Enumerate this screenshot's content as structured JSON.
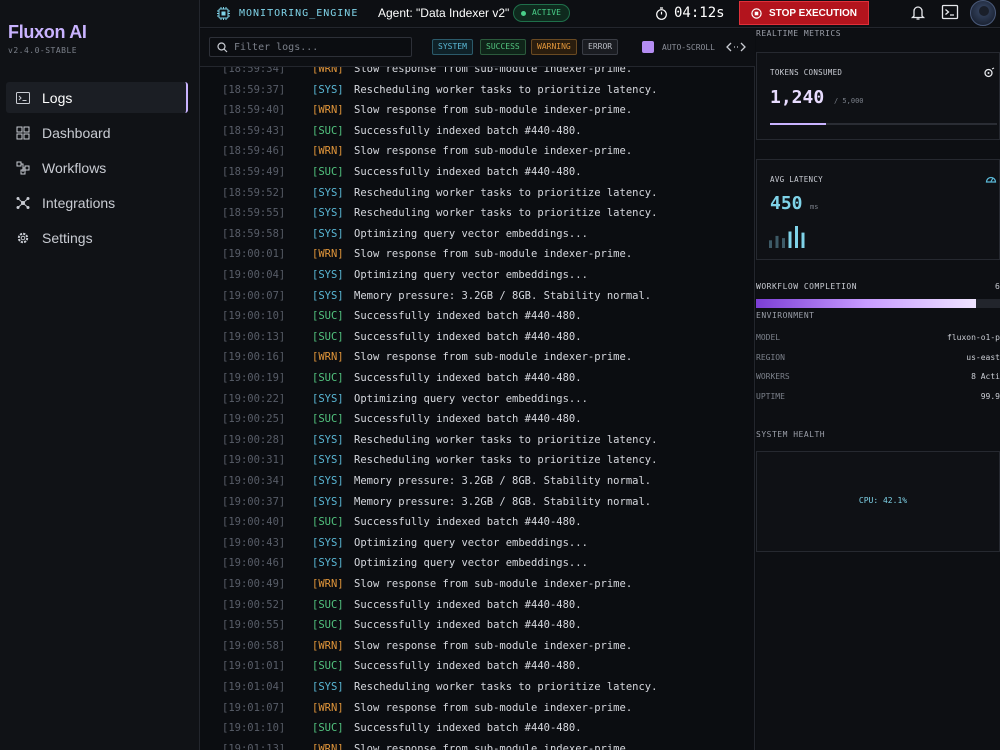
{
  "app": {
    "name": "Fluxon AI",
    "version": "v2.4.0-STABLE"
  },
  "sidebar": {
    "items": [
      {
        "label": "Logs",
        "icon": "terminal-icon",
        "active": true
      },
      {
        "label": "Dashboard",
        "icon": "grid-icon",
        "active": false
      },
      {
        "label": "Workflows",
        "icon": "workflow-icon",
        "active": false
      },
      {
        "label": "Integrations",
        "icon": "hub-icon",
        "active": false
      },
      {
        "label": "Settings",
        "icon": "gear-icon",
        "active": false
      }
    ]
  },
  "topbar": {
    "engine_label": "MONITORING_ENGINE",
    "agent_label": "Agent: \"Data Indexer v2\"",
    "status_badge": "ACTIVE",
    "timer": "04:12s",
    "stop_label": "STOP EXECUTION"
  },
  "filters": {
    "search_placeholder": "Filter logs...",
    "chips": [
      "SYSTEM",
      "SUCCESS",
      "WARNING",
      "ERROR"
    ],
    "autoscroll_label": "AUTO-SCROLL"
  },
  "logs": [
    {
      "time": "[18:59:34]",
      "tag": "WRN",
      "msg": "Slow response from sub-module indexer-prime."
    },
    {
      "time": "[18:59:37]",
      "tag": "SYS",
      "msg": "Rescheduling worker tasks to prioritize latency."
    },
    {
      "time": "[18:59:40]",
      "tag": "WRN",
      "msg": "Slow response from sub-module indexer-prime."
    },
    {
      "time": "[18:59:43]",
      "tag": "SUC",
      "msg": "Successfully indexed batch #440-480."
    },
    {
      "time": "[18:59:46]",
      "tag": "WRN",
      "msg": "Slow response from sub-module indexer-prime."
    },
    {
      "time": "[18:59:49]",
      "tag": "SUC",
      "msg": "Successfully indexed batch #440-480."
    },
    {
      "time": "[18:59:52]",
      "tag": "SYS",
      "msg": "Rescheduling worker tasks to prioritize latency."
    },
    {
      "time": "[18:59:55]",
      "tag": "SYS",
      "msg": "Rescheduling worker tasks to prioritize latency."
    },
    {
      "time": "[18:59:58]",
      "tag": "SYS",
      "msg": "Optimizing query vector embeddings..."
    },
    {
      "time": "[19:00:01]",
      "tag": "WRN",
      "msg": "Slow response from sub-module indexer-prime."
    },
    {
      "time": "[19:00:04]",
      "tag": "SYS",
      "msg": "Optimizing query vector embeddings..."
    },
    {
      "time": "[19:00:07]",
      "tag": "SYS",
      "msg": "Memory pressure: 3.2GB / 8GB. Stability normal."
    },
    {
      "time": "[19:00:10]",
      "tag": "SUC",
      "msg": "Successfully indexed batch #440-480."
    },
    {
      "time": "[19:00:13]",
      "tag": "SUC",
      "msg": "Successfully indexed batch #440-480."
    },
    {
      "time": "[19:00:16]",
      "tag": "WRN",
      "msg": "Slow response from sub-module indexer-prime."
    },
    {
      "time": "[19:00:19]",
      "tag": "SUC",
      "msg": "Successfully indexed batch #440-480."
    },
    {
      "time": "[19:00:22]",
      "tag": "SYS",
      "msg": "Optimizing query vector embeddings..."
    },
    {
      "time": "[19:00:25]",
      "tag": "SUC",
      "msg": "Successfully indexed batch #440-480."
    },
    {
      "time": "[19:00:28]",
      "tag": "SYS",
      "msg": "Rescheduling worker tasks to prioritize latency."
    },
    {
      "time": "[19:00:31]",
      "tag": "SYS",
      "msg": "Rescheduling worker tasks to prioritize latency."
    },
    {
      "time": "[19:00:34]",
      "tag": "SYS",
      "msg": "Memory pressure: 3.2GB / 8GB. Stability normal."
    },
    {
      "time": "[19:00:37]",
      "tag": "SYS",
      "msg": "Memory pressure: 3.2GB / 8GB. Stability normal."
    },
    {
      "time": "[19:00:40]",
      "tag": "SUC",
      "msg": "Successfully indexed batch #440-480."
    },
    {
      "time": "[19:00:43]",
      "tag": "SYS",
      "msg": "Optimizing query vector embeddings..."
    },
    {
      "time": "[19:00:46]",
      "tag": "SYS",
      "msg": "Optimizing query vector embeddings..."
    },
    {
      "time": "[19:00:49]",
      "tag": "WRN",
      "msg": "Slow response from sub-module indexer-prime."
    },
    {
      "time": "[19:00:52]",
      "tag": "SUC",
      "msg": "Successfully indexed batch #440-480."
    },
    {
      "time": "[19:00:55]",
      "tag": "SUC",
      "msg": "Successfully indexed batch #440-480."
    },
    {
      "time": "[19:00:58]",
      "tag": "WRN",
      "msg": "Slow response from sub-module indexer-prime."
    },
    {
      "time": "[19:01:01]",
      "tag": "SUC",
      "msg": "Successfully indexed batch #440-480."
    },
    {
      "time": "[19:01:04]",
      "tag": "SYS",
      "msg": "Rescheduling worker tasks to prioritize latency."
    },
    {
      "time": "[19:01:07]",
      "tag": "WRN",
      "msg": "Slow response from sub-module indexer-prime."
    },
    {
      "time": "[19:01:10]",
      "tag": "SUC",
      "msg": "Successfully indexed batch #440-480."
    },
    {
      "time": "[19:01:13]",
      "tag": "WRN",
      "msg": "Slow response from sub-module indexer-prime."
    }
  ],
  "metrics": {
    "title": "REALTIME METRICS",
    "tokens": {
      "label": "TOKENS CONSUMED",
      "value": "1,240",
      "max": "/ 5,000",
      "fraction": 0.248
    },
    "latency": {
      "label": "AVG LATENCY",
      "value": "450",
      "unit": "ms",
      "bars": [
        0.35,
        0.55,
        0.45,
        0.75,
        1.0,
        0.7
      ]
    },
    "workflow": {
      "label": "WORKFLOW COMPLETION",
      "value_partial": "6",
      "fraction": 0.9
    }
  },
  "environment": {
    "title": "ENVIRONMENT",
    "rows": [
      {
        "key": "MODEL",
        "value": "fluxon-o1-p"
      },
      {
        "key": "REGION",
        "value": "us-east"
      },
      {
        "key": "WORKERS",
        "value": "8 Acti"
      },
      {
        "key": "UPTIME",
        "value": "99.9"
      }
    ]
  },
  "health": {
    "title": "SYSTEM HEALTH",
    "cpu": "CPU: 42.1%"
  },
  "colors": {
    "accent": "#c9b3ff",
    "sys": "#5ab8d6",
    "suc": "#52c27e",
    "wrn": "#e0953a",
    "danger": "#b3141d"
  }
}
